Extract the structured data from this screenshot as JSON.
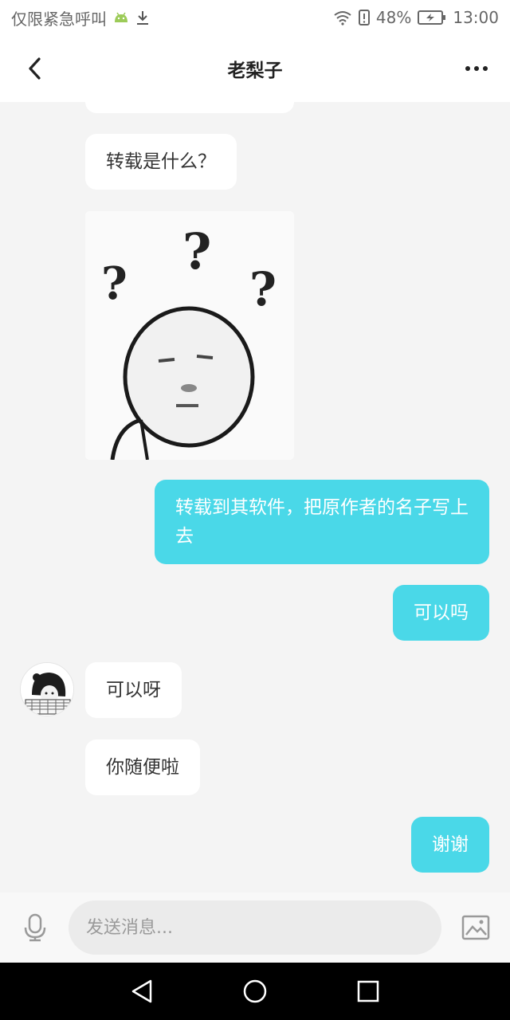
{
  "status_bar": {
    "carrier_text": "仅限紧急呼叫",
    "battery_percent": "48%",
    "time": "13:00",
    "icons": [
      "android-icon",
      "download-icon",
      "wifi-icon",
      "alert-icon",
      "battery-icon"
    ]
  },
  "header": {
    "title": "老梨子",
    "icons": [
      "back-icon",
      "more-icon"
    ]
  },
  "messages": [
    {
      "side": "in",
      "text": "转载是什么？"
    },
    {
      "side": "in",
      "type": "sticker",
      "icon": "confused-face-sticker"
    },
    {
      "side": "out",
      "text": "转载到其软件，把原作者的名子写上去"
    },
    {
      "side": "out",
      "text": "可以吗"
    },
    {
      "side": "in",
      "text": "可以呀"
    },
    {
      "side": "in",
      "text": "你随便啦"
    },
    {
      "side": "out",
      "text": "谢谢"
    }
  ],
  "input": {
    "placeholder": "发送消息...",
    "icons": [
      "microphone-icon",
      "image-icon"
    ]
  },
  "nav": {
    "icons": [
      "nav-back-icon",
      "nav-home-icon",
      "nav-recents-icon"
    ]
  },
  "colors": {
    "outgoing_bubble": "#4ad8e8",
    "incoming_bubble": "#ffffff",
    "chat_background": "#f4f4f4"
  }
}
